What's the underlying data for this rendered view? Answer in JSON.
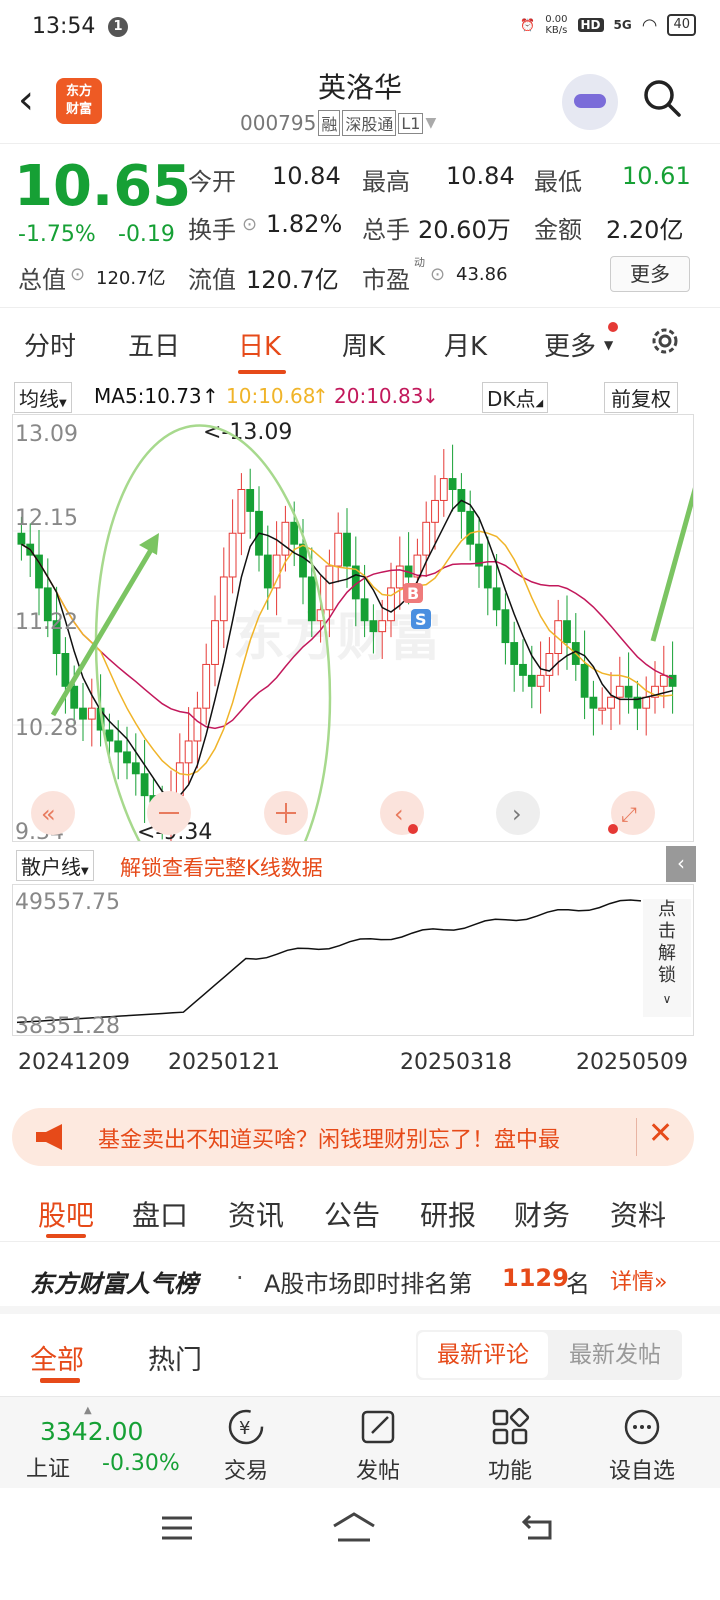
{
  "status_bar": {
    "time": "13:54",
    "notification": "1",
    "net_speed_value": "0.00",
    "net_speed_unit": "KB/s",
    "hd": "HD",
    "signal": "5G",
    "battery": "40"
  },
  "header": {
    "logo_line1": "东方",
    "logo_line2": "财富",
    "stock_name": "英洛华",
    "stock_code": "000795",
    "tags": [
      "融",
      "深股通",
      "L1"
    ]
  },
  "quote": {
    "price": "10.65",
    "change_pct": "-1.75%",
    "change_amt": "-0.19",
    "open_label": "今开",
    "open": "10.84",
    "high_label": "最高",
    "high": "10.84",
    "low_label": "最低",
    "low": "10.61",
    "turnover_label": "换手",
    "turnover": "1.82%",
    "volume_label": "总手",
    "volume": "20.60万",
    "amount_label": "金额",
    "amount": "2.20亿",
    "total_cap_label": "总值",
    "total_cap": "120.7亿",
    "float_cap_label": "流值",
    "float_cap": "120.7亿",
    "pe_label": "市盈",
    "pe_sup": "动",
    "pe": "43.86",
    "more_button": "更多"
  },
  "period_tabs": [
    "分时",
    "五日",
    "日K",
    "周K",
    "月K",
    "更多"
  ],
  "active_period": "日K",
  "ma_bar": {
    "dropdown": "均线",
    "ma5": "MA5:10.73",
    "ma10": "10:10.68",
    "ma20": "20:10.83",
    "dk_button": "DK点",
    "adjust_button": "前复权"
  },
  "chart_labels": {
    "y_ticks": [
      "13.09",
      "12.15",
      "11.22",
      "10.28",
      "9.34"
    ],
    "high_mark": "<-13.09",
    "low_mark": "<-9.34",
    "b_marker": "B",
    "s_marker": "S",
    "watermark": "东方财富"
  },
  "indicator": {
    "dropdown": "散户线",
    "unlock_text": "解锁查看完整K线数据",
    "top_value": "49557.75",
    "bottom_value": "38351.28",
    "side_unlock": [
      "点",
      "击",
      "解",
      "锁"
    ]
  },
  "date_ticks": [
    "20241209",
    "20250121",
    "20250318",
    "20250509"
  ],
  "banner": {
    "text": "基金卖出不知道买啥？闲钱理财别忘了！盘中最"
  },
  "content_tabs": [
    "股吧",
    "盘口",
    "资讯",
    "公告",
    "研报",
    "财务",
    "资料"
  ],
  "active_content_tab": "股吧",
  "rank": {
    "title": "东方财富人气榜",
    "dot": "·",
    "prefix": "A股市场即时排名第",
    "rank": "1129",
    "suffix": "名",
    "detail": "详情"
  },
  "sub_tabs": {
    "all": "全部",
    "hot": "热门",
    "latest_comment": "最新评论",
    "latest_post": "最新发帖"
  },
  "bottom_bar": {
    "index_value": "3342.00",
    "index_name": "上证",
    "index_change": "-0.30%",
    "items": [
      "交易",
      "发帖",
      "功能",
      "设自选"
    ]
  },
  "colors": {
    "accent": "#e64a19",
    "down": "#16a035",
    "up": "#e53935",
    "ma5": "#111111",
    "ma10": "#f0b429",
    "ma20": "#c2185b"
  }
}
